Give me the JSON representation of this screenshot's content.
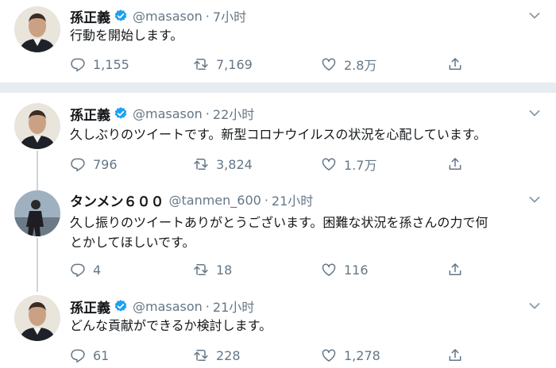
{
  "tweets": [
    {
      "name": "孫正義",
      "verified": true,
      "handle": "@masason",
      "dot": "·",
      "time": "7小时",
      "text": "行動を開始します。",
      "replies": "1,155",
      "retweets": "7,169",
      "likes": "2.8万"
    },
    {
      "name": "孫正義",
      "verified": true,
      "handle": "@masason",
      "dot": "·",
      "time": "22小时",
      "text": "久しぶりのツイートです。新型コロナウイルスの状況を心配しています。",
      "replies": "796",
      "retweets": "3,824",
      "likes": "1.7万"
    },
    {
      "name": "タンメン６００",
      "verified": false,
      "handle": "@tanmen_600",
      "dot": "·",
      "time": "21小时",
      "text_line1": "久し振りのツイートありがとうございます。困難な状況を孫さんの力で何",
      "text_line2": "とかしてほしいです。",
      "replies": "4",
      "retweets": "18",
      "likes": "116"
    },
    {
      "name": "孫正義",
      "verified": true,
      "handle": "@masason",
      "dot": "·",
      "time": "21小时",
      "text": "どんな貢献ができるか検討します。",
      "replies": "61",
      "retweets": "228",
      "likes": "1,278"
    }
  ],
  "icons": {
    "reply": "reply-icon",
    "retweet": "retweet-icon",
    "like": "like-icon",
    "share": "share-icon",
    "more": "chevron-down-icon",
    "verified": "verified-badge-icon"
  },
  "colors": {
    "text": "#14171a",
    "muted": "#657786",
    "verified": "#1da1f2",
    "separator": "#e6ecf0",
    "thread_line": "#ccd6dd"
  }
}
